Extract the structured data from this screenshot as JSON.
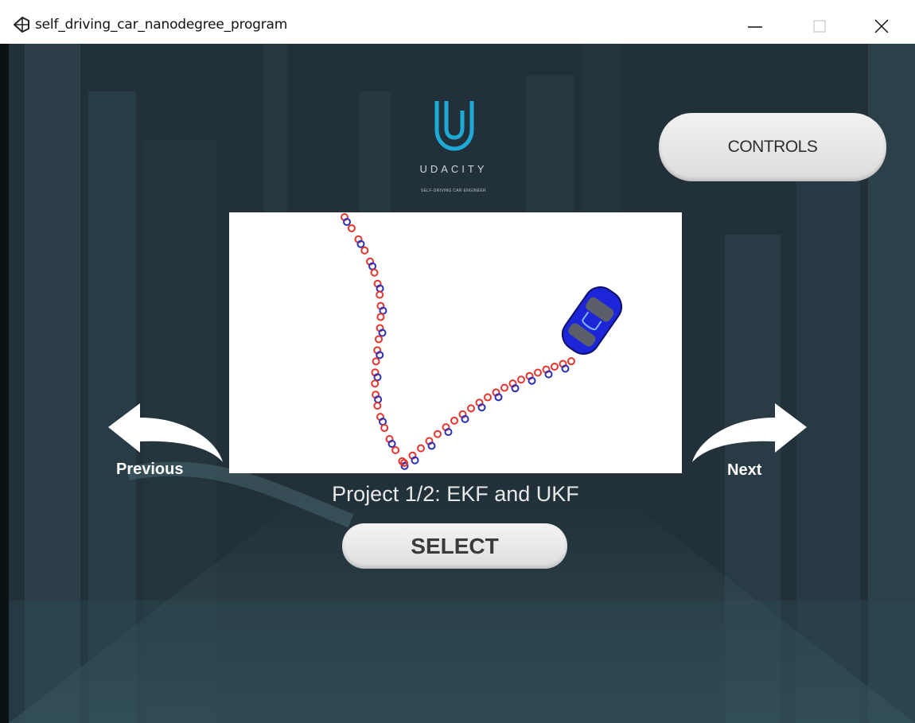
{
  "window": {
    "title": "self_driving_car_nanodegree_program",
    "icon": "unity-icon",
    "controls": [
      "minimize-icon",
      "maximize-icon",
      "close-icon"
    ]
  },
  "logo": {
    "icon": "udacity-u-icon",
    "wordmark": "UDACITY",
    "subtitle": "SELF-DRIVING CAR ENGINEER",
    "color": "#1fa9d6"
  },
  "controls_button": {
    "label": "CONTROLS"
  },
  "navigation": {
    "previous_label": "Previous",
    "next_label": "Next",
    "previous_icon": "curved-arrow-left-icon",
    "next_icon": "curved-arrow-right-icon"
  },
  "project": {
    "title": "Project 1/2: EKF and UKF",
    "preview_icon": "car-icon",
    "marker_colors": {
      "measurement": "#e8342c",
      "estimate": "#2a2fb8"
    }
  },
  "select_button": {
    "label": "SELECT"
  }
}
